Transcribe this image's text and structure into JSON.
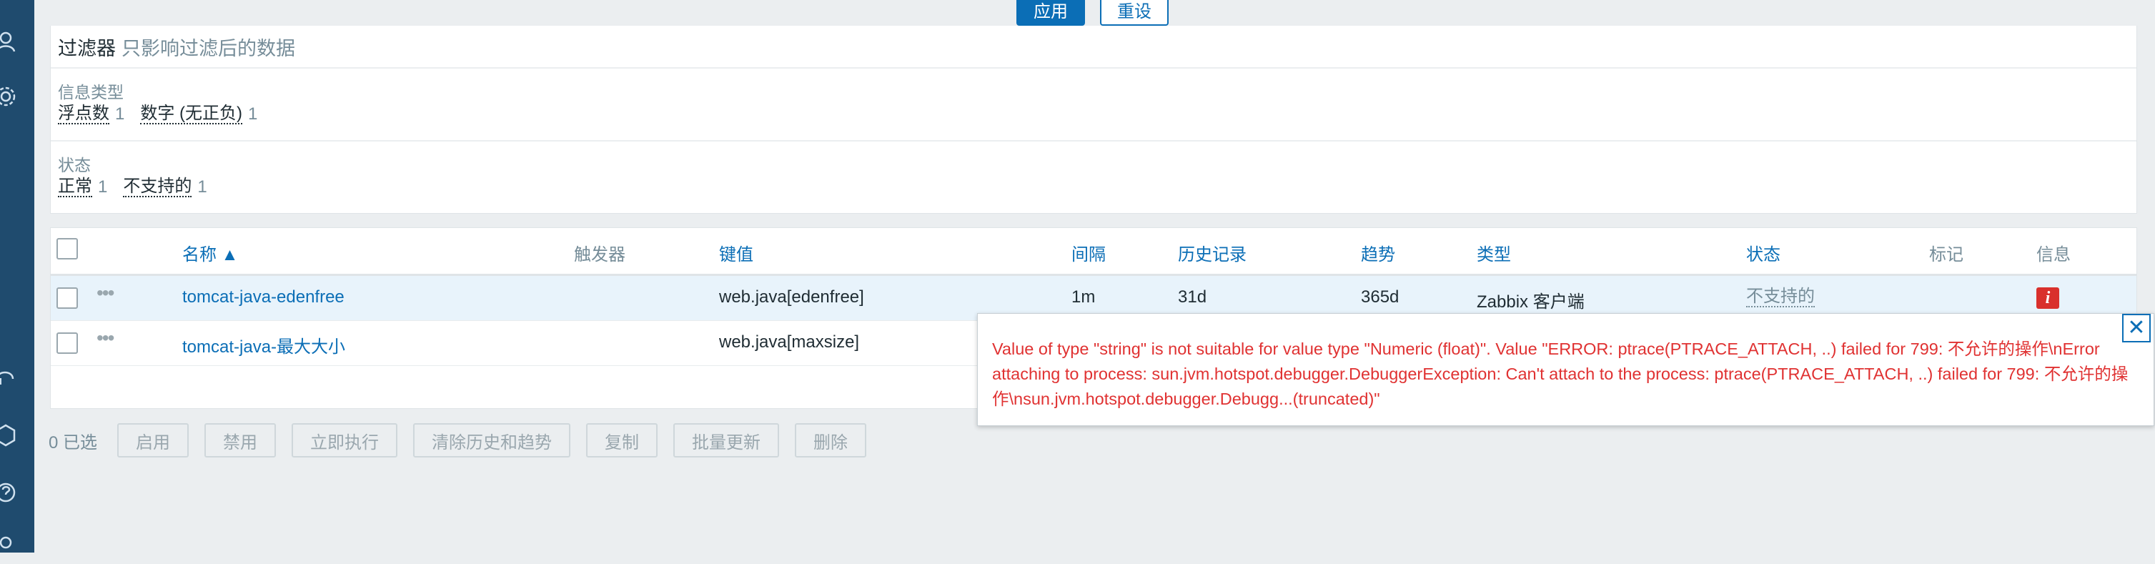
{
  "filter": {
    "apply_label": "应用",
    "reset_label": "重设",
    "title": "过滤器",
    "subtitle": "只影响过滤后的数据",
    "info_type": {
      "label": "信息类型",
      "options": [
        {
          "label": "浮点数",
          "count": "1"
        },
        {
          "label": "数字 (无正负)",
          "count": "1"
        }
      ]
    },
    "state": {
      "label": "状态",
      "options": [
        {
          "label": "正常",
          "count": "1"
        },
        {
          "label": "不支持的",
          "count": "1"
        }
      ]
    }
  },
  "table": {
    "columns": {
      "name": "名称 ▲",
      "triggers": "触发器",
      "key": "键值",
      "interval": "间隔",
      "history": "历史记录",
      "trends": "趋势",
      "type": "类型",
      "status": "状态",
      "tags": "标记",
      "info": "信息"
    },
    "rows": [
      {
        "name": "tomcat-java-edenfree",
        "key": "web.java[edenfree]",
        "interval": "1m",
        "history": "31d",
        "trends": "365d",
        "type": "Zabbix 客户端",
        "status": "不支持的",
        "info_icon": "i"
      },
      {
        "name": "tomcat-java-最大大小",
        "key": "web.java[maxsize]"
      }
    ]
  },
  "footer": {
    "selected": "0 已选",
    "actions": [
      "启用",
      "禁用",
      "立即执行",
      "清除历史和趋势",
      "复制",
      "批量更新",
      "删除"
    ]
  },
  "popup": {
    "message": "Value of type \"string\" is not suitable for value type \"Numeric (float)\". Value \"ERROR: ptrace(PTRACE_ATTACH, ..) failed for 799: 不允许的操作\\nError attaching to process: sun.jvm.hotspot.debugger.DebuggerException: Can't attach to the process: ptrace(PTRACE_ATTACH, ..) failed for 799: 不允许的操作\\nsun.jvm.hotspot.debugger.Debugg...(truncated)\"",
    "close_symbol": "✕"
  }
}
